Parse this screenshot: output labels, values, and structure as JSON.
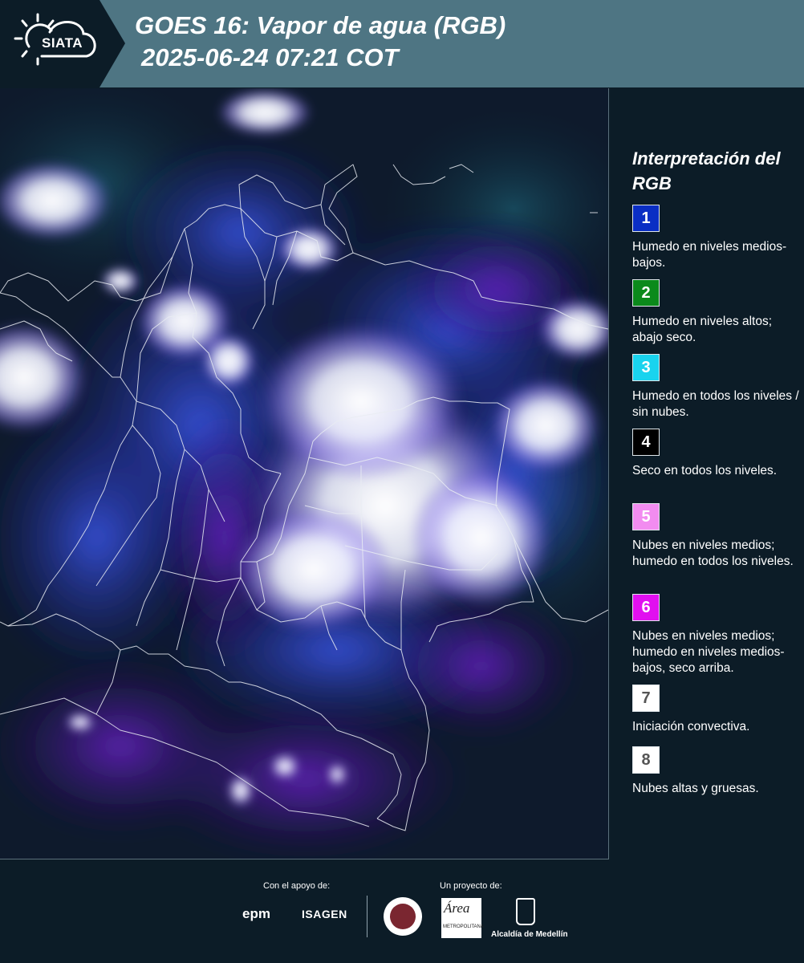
{
  "header": {
    "logo_text": "SIATA",
    "title_line1": "GOES 16: Vapor de agua (RGB)",
    "title_line2": "2025-06-24 07:21 COT"
  },
  "legend": {
    "title": "Interpretación del RGB",
    "items": [
      {
        "number": "1",
        "color": "#0a2ec4",
        "text_color": "#ffffff",
        "description": "Humedo en niveles medios-bajos."
      },
      {
        "number": "2",
        "color": "#0b8a1b",
        "text_color": "#ffffff",
        "description": "Humedo en niveles altos; abajo seco."
      },
      {
        "number": "3",
        "color": "#19d3ee",
        "text_color": "#ffffff",
        "description": "Humedo en todos los niveles / sin nubes."
      },
      {
        "number": "4",
        "color": "#000000",
        "text_color": "#ffffff",
        "description": "Seco en todos los niveles."
      },
      {
        "number": "5",
        "color": "#f28cf0",
        "text_color": "#ffffff",
        "description": "Nubes en niveles medios; humedo en todos los niveles."
      },
      {
        "number": "6",
        "color": "#e10ff0",
        "text_color": "#ffffff",
        "description": "Nubes en niveles medios; humedo en niveles medios-bajos, seco arriba."
      },
      {
        "number": "7",
        "color": "#ffffff",
        "text_color": "#555555",
        "description": "Iniciación convectiva."
      },
      {
        "number": "8",
        "color": "#ffffff",
        "text_color": "#555555",
        "description": "Nubes altas y gruesas."
      }
    ]
  },
  "footer": {
    "support_label": "Con el apoyo de:",
    "project_label": "Un proyecto de:",
    "epm": "epm",
    "isagen": "ISAGEN",
    "metro_logo": "Área",
    "metro_sub": "METROPOLITANA",
    "alcaldia": "Alcaldía de Medellín"
  }
}
